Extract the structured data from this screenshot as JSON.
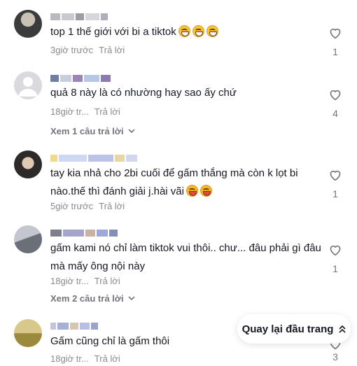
{
  "comments": [
    {
      "text": "top 1 thế giới với bi a tiktok",
      "emoji": [
        "grin-icon",
        "grin-icon",
        "grin-icon"
      ],
      "time": "3giờ trước",
      "reply_label": "Trả lời",
      "likes": "1",
      "avatar_colors": [
        "#3b3b3b",
        "#c9c1b4"
      ],
      "name_colors": [
        "#b9b9c2",
        "#c9c9d0",
        "#9d9da8",
        "#d6d6dc",
        "#b0b0ba"
      ]
    },
    {
      "text": "quả 8 này là có nhường hay sao ấy chứ",
      "time": "18giờ tr...",
      "reply_label": "Trả lời",
      "likes": "4",
      "view_replies": "Xem 1 câu trả lời",
      "avatar_colors": [
        "#d9d9de",
        "#ffffff"
      ],
      "name_colors": [
        "#6f7fa3",
        "#c8cde0",
        "#9a84b8",
        "#b6c7e8",
        "#8a7ab1"
      ]
    },
    {
      "text": "tay kia nhả cho 2bi cuối để gấm thắng mà còn k lọt bi nào.thế thì đánh giải j.hài vãi",
      "emoji": [
        "laugh-cry-icon",
        "laugh-cry-icon"
      ],
      "time": "5giờ trước",
      "reply_label": "Trả lời",
      "likes": "1",
      "avatar_colors": [
        "#2e2a2a",
        "#e0c9b3"
      ],
      "name_colors": [
        "#f1d98a",
        "#cfd8f2",
        "#bcc3e8",
        "#e9d6a3",
        "#d0d7ee"
      ]
    },
    {
      "text": "gấm kami nó chỉ làm tiktok vui thôi.. chư... đâu phải gì đâu mà mấy ông nội này",
      "time": "18giờ tr...",
      "reply_label": "Trả lời",
      "likes": "1",
      "view_replies": "Xem 2 câu trả lời",
      "avatar_colors": [
        "#6b6f78",
        "#c3c6cf"
      ],
      "name_colors": [
        "#7d7f8f",
        "#a3a6c9",
        "#c8b2a4",
        "#9fa9d8",
        "#8390b5"
      ]
    },
    {
      "text": "Gấm cũng chỉ là gấm thôi",
      "time": "18giờ tr...",
      "reply_label": "Trả lời",
      "likes": "3",
      "avatar_colors": [
        "#9b8a3e",
        "#d8c98a"
      ],
      "name_colors": [
        "#c3c5d8",
        "#a7b0d6",
        "#d6c5b3",
        "#b8bfe4",
        "#9aa3c9"
      ]
    }
  ],
  "back_to_top": {
    "label": "Quay lại đầu trang",
    "icon": "double-chevron-up-icon"
  }
}
